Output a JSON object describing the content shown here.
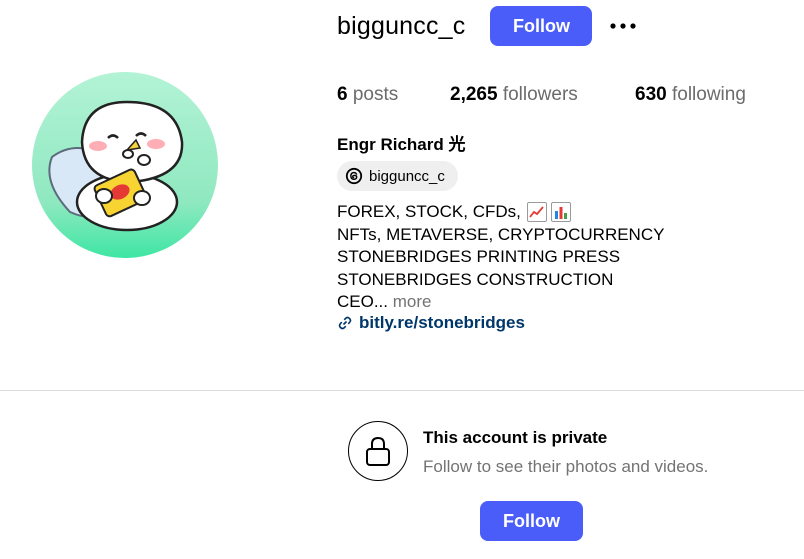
{
  "profile": {
    "username": "bigguncc_c",
    "follow_label": "Follow",
    "more_icon": "more-horizontal-icon",
    "avatar_icon": "sticker-character-eating-chips-avatar"
  },
  "stats": {
    "posts_count": "6",
    "posts_label": "posts",
    "followers_count": "2,265",
    "followers_label": "followers",
    "following_count": "630",
    "following_label": "following"
  },
  "bio": {
    "full_name": "Engr Richard 光",
    "threads_handle": "bigguncc_c",
    "threads_icon": "threads-icon",
    "lines": [
      "FOREX, STOCK, CFDs,",
      "NFTs, METAVERSE, CRYPTOCURRENCY",
      "STONEBRIDGES PRINTING PRESS",
      "STONEBRIDGES CONSTRUCTION",
      "CEO..."
    ],
    "emoji_icons": [
      "chart-increasing-icon",
      "bar-chart-icon"
    ],
    "more_label": "more",
    "link_icon": "link-icon",
    "link_text": "bitly.re/stonebridges"
  },
  "private_section": {
    "lock_icon": "lock-icon",
    "title": "This account is private",
    "subtitle": "Follow to see their photos and videos.",
    "follow_label": "Follow"
  },
  "colors": {
    "accent": "#4a5df9",
    "link": "#00376b",
    "muted": "#737373",
    "avatar_bg": "#a8f0cf"
  }
}
